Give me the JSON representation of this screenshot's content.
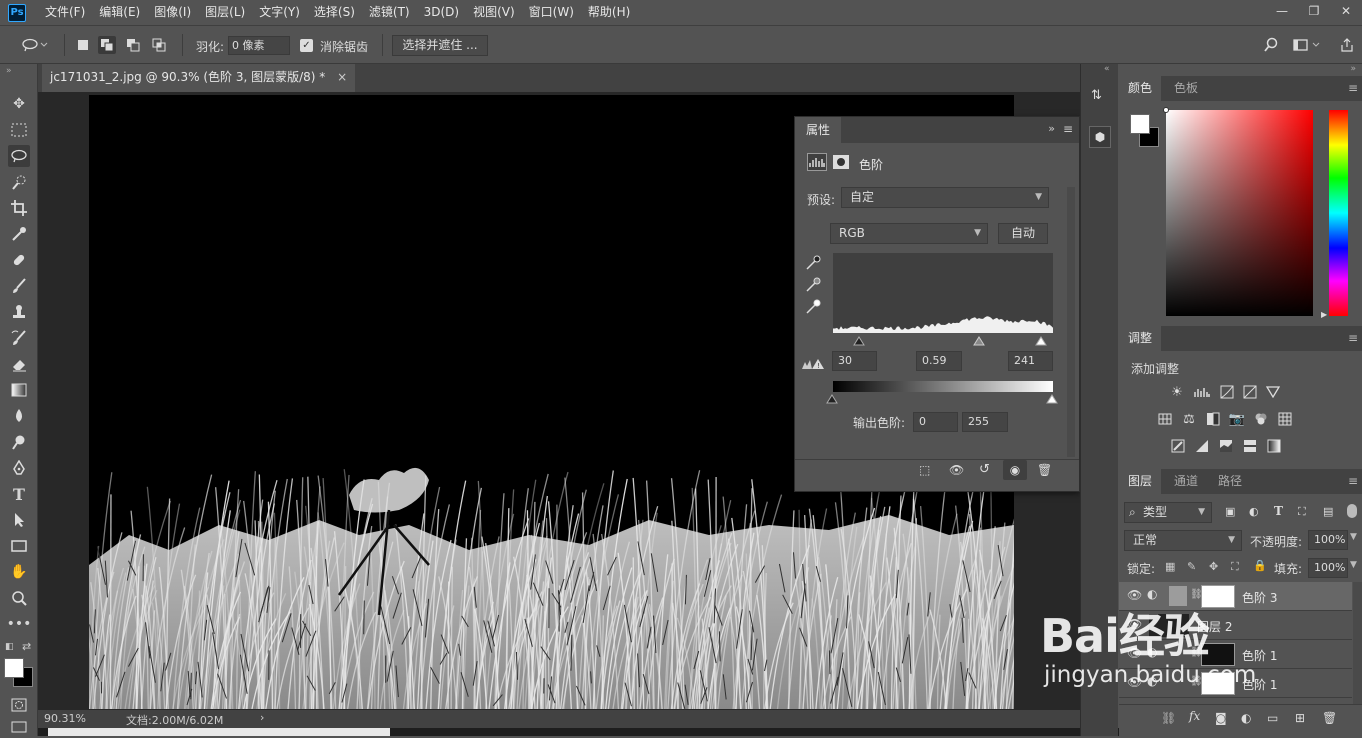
{
  "app": {
    "logo": "Ps"
  },
  "menu": [
    "文件(F)",
    "编辑(E)",
    "图像(I)",
    "图层(L)",
    "文字(Y)",
    "选择(S)",
    "滤镜(T)",
    "3D(D)",
    "视图(V)",
    "窗口(W)",
    "帮助(H)"
  ],
  "window_controls": {
    "minimize": "—",
    "restore": "❐",
    "close": "✕"
  },
  "options": {
    "feather_label": "羽化:",
    "feather_value": "0 像素",
    "antialias_checked": true,
    "antialias_label": "消除锯齿",
    "select_mask_label": "选择并遮住 ..."
  },
  "document": {
    "tab_title": "jc171031_2.jpg @ 90.3% (色阶 3, 图层蒙版/8) *",
    "tab_close": "×"
  },
  "status": {
    "zoom": "90.31%",
    "doc_info": "文档:2.00M/6.02M",
    "arrow": "›"
  },
  "properties": {
    "tab": "属性",
    "type_label": "色阶",
    "preset_label": "预设:",
    "preset_value": "自定",
    "channel_value": "RGB",
    "auto_label": "自动",
    "input_black": "30",
    "input_gamma": "0.59",
    "input_white": "241",
    "output_label": "输出色阶:",
    "output_black": "0",
    "output_white": "255"
  },
  "color_panel": {
    "tabs": [
      "颜色",
      "色板"
    ],
    "foreground": "#ffffff",
    "background": "#000000"
  },
  "adjustments_panel": {
    "tab": "调整",
    "add_label": "添加调整"
  },
  "layers_panel": {
    "tabs": [
      "图层",
      "通道",
      "路径"
    ],
    "filter_kind": "类型",
    "blend_mode": "正常",
    "opacity_label": "不透明度:",
    "opacity_value": "100%",
    "lock_label": "锁定:",
    "fill_label": "填充:",
    "fill_value": "100%",
    "layers": [
      {
        "name": "色阶 3",
        "selected": true
      },
      {
        "name": "图层 2",
        "selected": false
      },
      {
        "name": "色阶 1",
        "selected": false
      },
      {
        "name": "色阶 1",
        "selected": false
      }
    ]
  },
  "watermark": {
    "brand": "Bai经验",
    "url": "jingyan.baidu.com"
  }
}
